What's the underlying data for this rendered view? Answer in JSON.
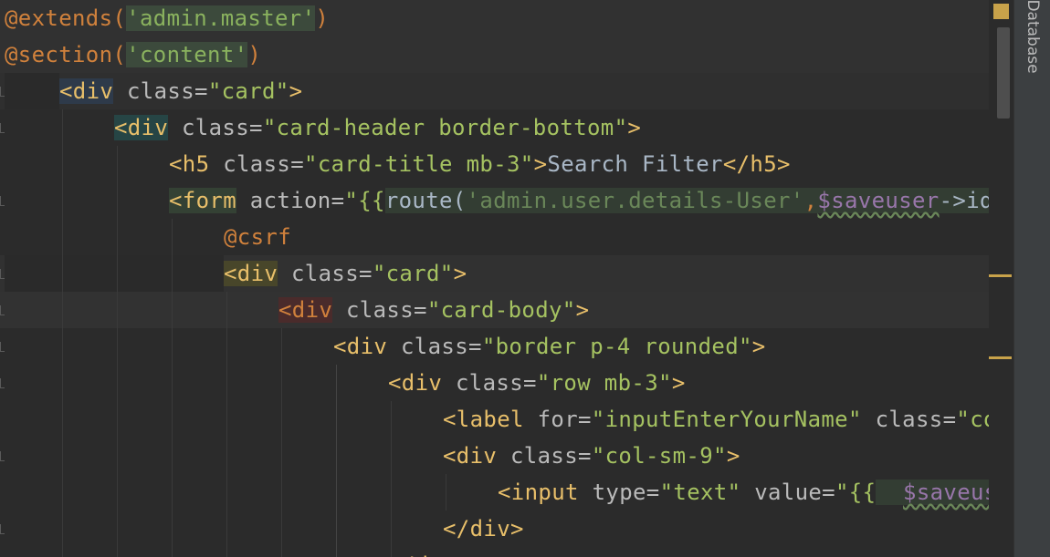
{
  "editor": {
    "lines": [
      {
        "segments": [
          {
            "t": "@extends(",
            "c": "ann"
          },
          {
            "t": "'admin.master'",
            "c": "strbg"
          },
          {
            "t": ")",
            "c": "ann"
          }
        ]
      },
      {
        "segments": [
          {
            "t": "@section(",
            "c": "ann"
          },
          {
            "t": "'content'",
            "c": "strbg"
          },
          {
            "t": ")",
            "c": "ann"
          }
        ]
      },
      {
        "segments": [
          {
            "t": "<div",
            "c": "tag tagbg1"
          },
          {
            "t": " class=",
            "c": "attr"
          },
          {
            "t": "\"card\"",
            "c": "aval"
          },
          {
            "t": ">",
            "c": "tag"
          }
        ]
      },
      {
        "segments": [
          {
            "t": "<div",
            "c": "tag tagbg2"
          },
          {
            "t": " class=",
            "c": "attr"
          },
          {
            "t": "\"card-header border-bottom\"",
            "c": "aval"
          },
          {
            "t": ">",
            "c": "tag"
          }
        ]
      },
      {
        "segments": [
          {
            "t": "<h5",
            "c": "tag"
          },
          {
            "t": " class=",
            "c": "attr"
          },
          {
            "t": "\"card-title mb-3\"",
            "c": "aval"
          },
          {
            "t": ">",
            "c": "tag"
          },
          {
            "t": "Search Filter",
            "c": "txt"
          },
          {
            "t": "</h5>",
            "c": "tag"
          }
        ]
      },
      {
        "segments": [
          {
            "t": "<form",
            "c": "tag tagbg3"
          },
          {
            "t": " action=",
            "c": "attr"
          },
          {
            "t": "\"{{",
            "c": "aval"
          },
          {
            "t": "route(",
            "c": "txt phpbg"
          },
          {
            "t": "'admin.user.details-User'",
            "c": "str phpbg"
          },
          {
            "t": ",",
            "c": "ann phpbg"
          },
          {
            "t": "$saveuser",
            "c": "var phpbg"
          },
          {
            "t": "->id)",
            "c": "txt phpbg"
          }
        ]
      },
      {
        "segments": [
          {
            "t": "@csrf",
            "c": "ann"
          }
        ]
      },
      {
        "segments": [
          {
            "t": "<div",
            "c": "tag tagbg4"
          },
          {
            "t": " class=",
            "c": "attr"
          },
          {
            "t": "\"card\"",
            "c": "aval"
          },
          {
            "t": ">",
            "c": "tag"
          }
        ]
      },
      {
        "segments": [
          {
            "t": "<div",
            "c": "tagbg5"
          },
          {
            "t": " class=",
            "c": "attr"
          },
          {
            "t": "\"card-body\"",
            "c": "aval"
          },
          {
            "t": ">",
            "c": "tag"
          }
        ]
      },
      {
        "segments": [
          {
            "t": "<div",
            "c": "tag"
          },
          {
            "t": " class=",
            "c": "attr"
          },
          {
            "t": "\"border p-4 rounded\"",
            "c": "aval"
          },
          {
            "t": ">",
            "c": "tag"
          }
        ]
      },
      {
        "segments": [
          {
            "t": "<div",
            "c": "tag"
          },
          {
            "t": " class=",
            "c": "attr"
          },
          {
            "t": "\"row mb-3\"",
            "c": "aval"
          },
          {
            "t": ">",
            "c": "tag"
          }
        ]
      },
      {
        "segments": [
          {
            "t": "<label",
            "c": "tag"
          },
          {
            "t": " for=",
            "c": "attr"
          },
          {
            "t": "\"inputEnterYourName\"",
            "c": "aval"
          },
          {
            "t": " class=",
            "c": "attr"
          },
          {
            "t": "\"col",
            "c": "aval"
          }
        ]
      },
      {
        "segments": [
          {
            "t": "<div",
            "c": "tag"
          },
          {
            "t": " class=",
            "c": "attr"
          },
          {
            "t": "\"col-sm-9\"",
            "c": "aval"
          },
          {
            "t": ">",
            "c": "tag"
          }
        ]
      },
      {
        "segments": [
          {
            "t": "<input",
            "c": "tag"
          },
          {
            "t": " type=",
            "c": "attr"
          },
          {
            "t": "\"text\"",
            "c": "aval"
          },
          {
            "t": " value=",
            "c": "attr"
          },
          {
            "t": "\"{{",
            "c": "aval"
          },
          {
            "t": "  ",
            "c": "phpbg"
          },
          {
            "t": "$saveuse",
            "c": "var phpbg"
          }
        ]
      },
      {
        "segments": [
          {
            "t": "</div>",
            "c": "tag"
          }
        ]
      },
      {
        "segments": [
          {
            "t": "</d",
            "c": "tag"
          }
        ]
      }
    ]
  },
  "sidebar": {
    "database_tab": "Database"
  }
}
